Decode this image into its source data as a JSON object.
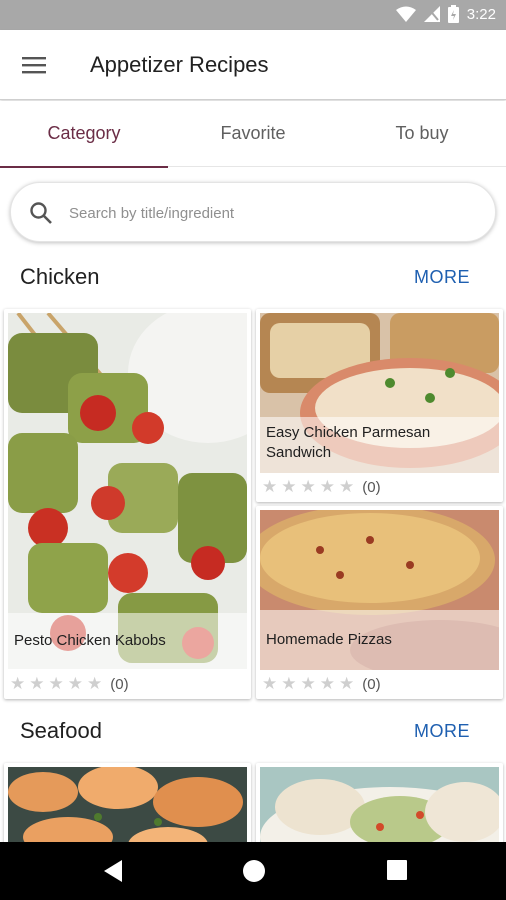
{
  "status_bar": {
    "time": "3:22",
    "icons": [
      "wifi-icon",
      "signal-icon",
      "battery-icon"
    ]
  },
  "app_bar": {
    "menu_icon": "hamburger-menu-icon",
    "title": "Appetizer Recipes"
  },
  "tabs": [
    {
      "label": "Category",
      "active": true
    },
    {
      "label": "Favorite",
      "active": false
    },
    {
      "label": "To buy",
      "active": false
    }
  ],
  "search": {
    "placeholder": "Search by title/ingredient",
    "icon": "search-icon"
  },
  "sections": [
    {
      "title": "Chicken",
      "more_label": "MORE",
      "recipes": [
        {
          "title": "Pesto Chicken Kabobs",
          "rating_count": "(0)"
        },
        {
          "title": "Easy Chicken Parmesan Sandwich",
          "rating_count": "(0)"
        },
        {
          "title": "Homemade Pizzas",
          "rating_count": "(0)"
        }
      ]
    },
    {
      "title": "Seafood",
      "more_label": "MORE"
    }
  ],
  "colors": {
    "accent": "#6b2d46",
    "link": "#1e5fb0",
    "status_bar": "#a8a8a8"
  },
  "nav_bar": {
    "icons": [
      "back-icon",
      "home-icon",
      "recents-icon"
    ]
  }
}
